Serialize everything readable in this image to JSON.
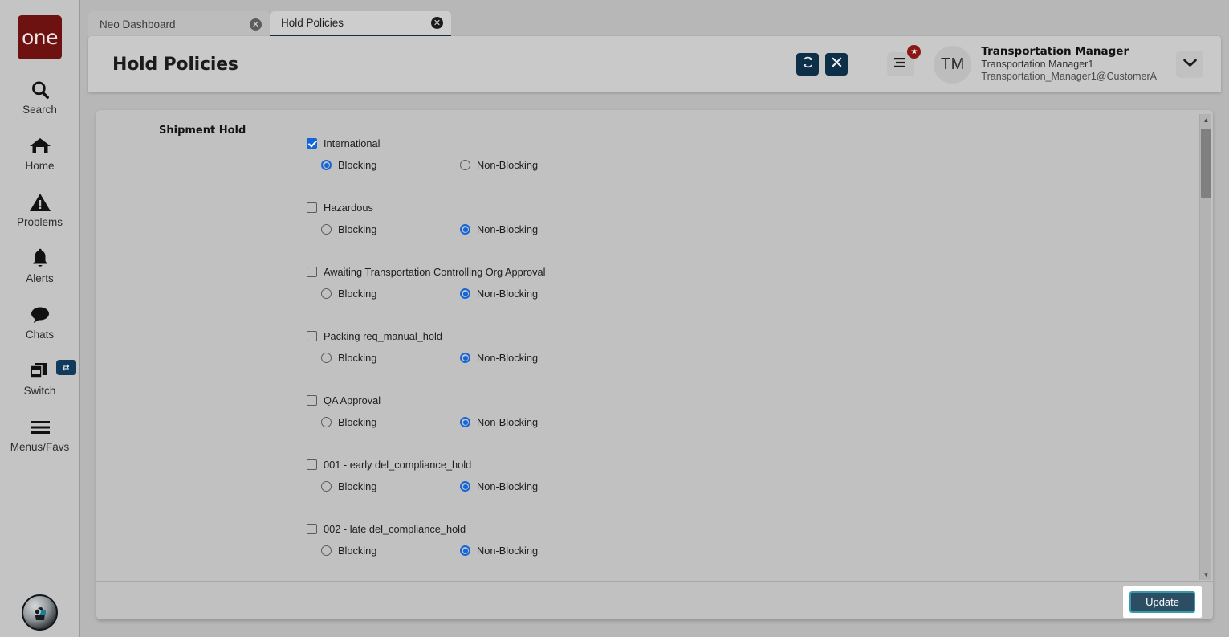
{
  "brand": {
    "logo_text": "one"
  },
  "sidebar": {
    "items": [
      {
        "label": "Search",
        "icon": "search-icon"
      },
      {
        "label": "Home",
        "icon": "home-icon"
      },
      {
        "label": "Problems",
        "icon": "warning-triangle-icon"
      },
      {
        "label": "Alerts",
        "icon": "bell-icon"
      },
      {
        "label": "Chats",
        "icon": "chat-bubble-icon"
      },
      {
        "label": "Switch",
        "icon": "windows-stack-icon",
        "badge_icon": "swap-arrows-icon"
      },
      {
        "label": "Menus/Favs",
        "icon": "hamburger-icon"
      }
    ],
    "assistant": {
      "icon": "ai-assistant-orb-icon"
    }
  },
  "tabs": [
    {
      "label": "Neo Dashboard",
      "active": false,
      "close_icon": "close-circle-icon"
    },
    {
      "label": "Hold Policies",
      "active": true,
      "close_icon": "close-circle-icon"
    }
  ],
  "header": {
    "title": "Hold Policies",
    "refresh_icon": "refresh-icon",
    "close_icon": "close-x-icon",
    "menus_favs_icon": "list-menu-icon",
    "favorite_badge_icon": "star-icon",
    "avatar_initials": "TM",
    "user_role": "Transportation Manager",
    "user_name": "Transportation Manager1",
    "user_login": "Transportation_Manager1@CustomerA",
    "caret_icon": "chevron-down-icon"
  },
  "content": {
    "section_label": "Shipment Hold",
    "blocking_label": "Blocking",
    "non_blocking_label": "Non-Blocking",
    "policies": [
      {
        "name": "International",
        "checked": true,
        "mode": "blocking"
      },
      {
        "name": "Hazardous",
        "checked": false,
        "mode": "non-blocking"
      },
      {
        "name": "Awaiting Transportation Controlling Org Approval",
        "checked": false,
        "mode": "non-blocking"
      },
      {
        "name": "Packing req_manual_hold",
        "checked": false,
        "mode": "non-blocking"
      },
      {
        "name": "QA Approval",
        "checked": false,
        "mode": "non-blocking"
      },
      {
        "name": "001 - early del_compliance_hold",
        "checked": false,
        "mode": "non-blocking"
      },
      {
        "name": "002 - late del_compliance_hold",
        "checked": false,
        "mode": "non-blocking"
      }
    ]
  },
  "footer": {
    "update_label": "Update"
  },
  "colors": {
    "brand_red": "#6e1111",
    "accent_navy": "#0e2f48",
    "control_blue": "#1565d8",
    "badge_red": "#8a1616",
    "button_teal_border": "#3a9aad",
    "button_slate": "#2b4e63"
  }
}
